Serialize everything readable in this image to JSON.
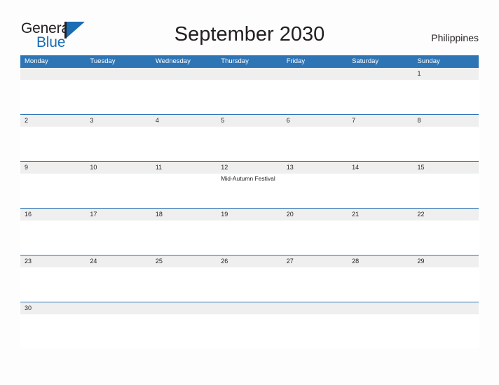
{
  "brand": {
    "word_one": "General",
    "word_two": "Blue",
    "logo_icon": "general-blue-triangle-logo"
  },
  "header": {
    "title": "September 2030",
    "country": "Philippines"
  },
  "colors": {
    "header_blue": "#2e75b6",
    "date_band_gray": "#efefef",
    "brand_blue": "#1a6cb5",
    "text_dark": "#231f20",
    "page_background": "#fdfdfd"
  },
  "calendar": {
    "weekdays": [
      "Monday",
      "Tuesday",
      "Wednesday",
      "Thursday",
      "Friday",
      "Saturday",
      "Sunday"
    ],
    "weeks": [
      {
        "days": [
          {
            "date": "",
            "event": ""
          },
          {
            "date": "",
            "event": ""
          },
          {
            "date": "",
            "event": ""
          },
          {
            "date": "",
            "event": ""
          },
          {
            "date": "",
            "event": ""
          },
          {
            "date": "",
            "event": ""
          },
          {
            "date": "1",
            "event": ""
          }
        ]
      },
      {
        "days": [
          {
            "date": "2",
            "event": ""
          },
          {
            "date": "3",
            "event": ""
          },
          {
            "date": "4",
            "event": ""
          },
          {
            "date": "5",
            "event": ""
          },
          {
            "date": "6",
            "event": ""
          },
          {
            "date": "7",
            "event": ""
          },
          {
            "date": "8",
            "event": ""
          }
        ]
      },
      {
        "days": [
          {
            "date": "9",
            "event": ""
          },
          {
            "date": "10",
            "event": ""
          },
          {
            "date": "11",
            "event": ""
          },
          {
            "date": "12",
            "event": "Mid-Autumn Festival"
          },
          {
            "date": "13",
            "event": ""
          },
          {
            "date": "14",
            "event": ""
          },
          {
            "date": "15",
            "event": ""
          }
        ]
      },
      {
        "days": [
          {
            "date": "16",
            "event": ""
          },
          {
            "date": "17",
            "event": ""
          },
          {
            "date": "18",
            "event": ""
          },
          {
            "date": "19",
            "event": ""
          },
          {
            "date": "20",
            "event": ""
          },
          {
            "date": "21",
            "event": ""
          },
          {
            "date": "22",
            "event": ""
          }
        ]
      },
      {
        "days": [
          {
            "date": "23",
            "event": ""
          },
          {
            "date": "24",
            "event": ""
          },
          {
            "date": "25",
            "event": ""
          },
          {
            "date": "26",
            "event": ""
          },
          {
            "date": "27",
            "event": ""
          },
          {
            "date": "28",
            "event": ""
          },
          {
            "date": "29",
            "event": ""
          }
        ]
      },
      {
        "days": [
          {
            "date": "30",
            "event": ""
          },
          {
            "date": "",
            "event": ""
          },
          {
            "date": "",
            "event": ""
          },
          {
            "date": "",
            "event": ""
          },
          {
            "date": "",
            "event": ""
          },
          {
            "date": "",
            "event": ""
          },
          {
            "date": "",
            "event": ""
          }
        ]
      }
    ]
  }
}
